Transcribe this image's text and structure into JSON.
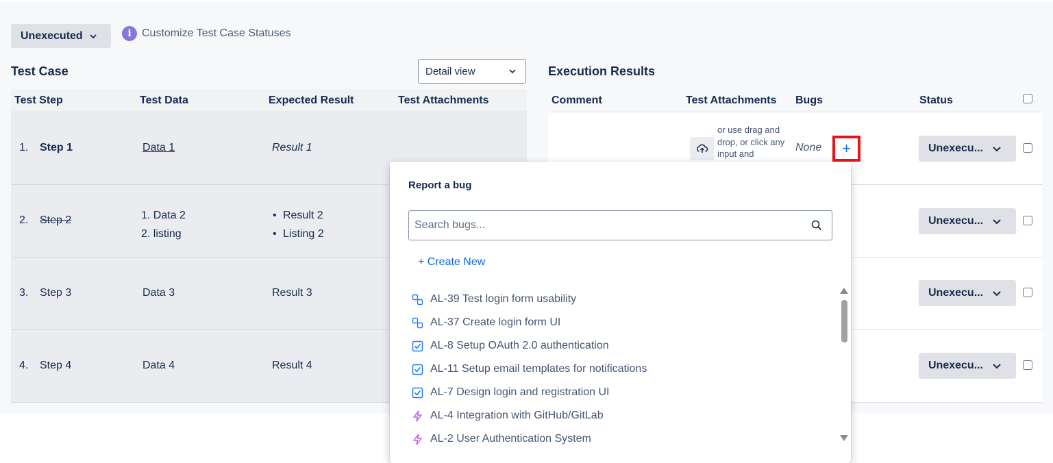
{
  "status_filter": {
    "label": "Unexecuted"
  },
  "customize": {
    "label": "Customize Test Case Statuses",
    "info_icon": "i"
  },
  "test_case": {
    "title": "Test Case",
    "view_select": "Detail view",
    "columns": [
      "Test Step",
      "Test Data",
      "Expected Result",
      "Test Attachments"
    ],
    "rows": [
      {
        "num": "1.",
        "step": "Step 1",
        "data": [
          "Data 1"
        ],
        "result": [
          "Result 1"
        ]
      },
      {
        "num": "2.",
        "step": "Step 2",
        "data": [
          "1. Data 2",
          "2. listing"
        ],
        "result": [
          "Result 2",
          "Listing 2"
        ]
      },
      {
        "num": "3.",
        "step": "Step 3",
        "data": [
          "Data 3"
        ],
        "result": [
          "Result 3"
        ]
      },
      {
        "num": "4.",
        "step": "Step 4",
        "data": [
          "Data 4"
        ],
        "result": [
          "Result 4"
        ]
      }
    ]
  },
  "execution": {
    "title": "Execution Results",
    "columns": [
      "Comment",
      "Test Attachments",
      "Bugs",
      "Status"
    ],
    "drag_text": "or use drag and drop, or click any input and",
    "bugs_none": "None",
    "add_bug": "+",
    "status_labels": [
      "Unexecu...",
      "Unexecu...",
      "Unexecu...",
      "Unexecu..."
    ]
  },
  "bug_popup": {
    "title": "Report a bug",
    "search_placeholder": "Search bugs...",
    "create_new": "+ Create New",
    "items": [
      {
        "key": "AL-39",
        "summary": "Test login form usability",
        "icon": "subtask-icon"
      },
      {
        "key": "AL-37",
        "summary": "Create login form UI",
        "icon": "subtask-icon"
      },
      {
        "key": "AL-8",
        "summary": "Setup OAuth 2.0 authentication",
        "icon": "task-icon"
      },
      {
        "key": "AL-11",
        "summary": "Setup email templates for notifications",
        "icon": "task-icon"
      },
      {
        "key": "AL-7",
        "summary": "Design login and registration UI",
        "icon": "task-icon"
      },
      {
        "key": "AL-4",
        "summary": "Integration with GitHub/GitLab",
        "icon": "epic-icon"
      },
      {
        "key": "AL-2",
        "summary": "User Authentication System",
        "icon": "epic-icon"
      }
    ]
  },
  "colors": {
    "accent": "#0c66e4",
    "highlight": "#e3161c",
    "epic": "#c252e1",
    "task": "#1d7afc"
  }
}
